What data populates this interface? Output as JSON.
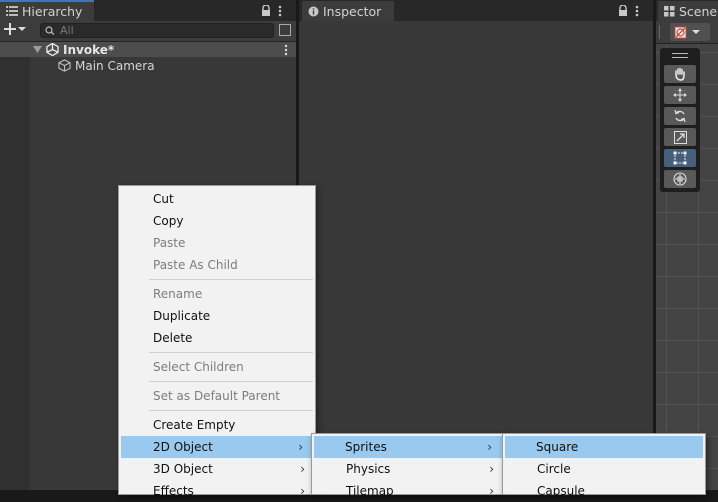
{
  "hierarchy": {
    "tab_label": "Hierarchy",
    "search_placeholder": "All",
    "scene_name": "Invoke*",
    "objects": [
      "Main Camera"
    ]
  },
  "inspector": {
    "tab_label": "Inspector"
  },
  "scene_view": {
    "tab_label": "Scene"
  },
  "context_menu": {
    "items": [
      {
        "label": "Cut",
        "enabled": true
      },
      {
        "label": "Copy",
        "enabled": true
      },
      {
        "label": "Paste",
        "enabled": false
      },
      {
        "label": "Paste As Child",
        "enabled": false
      },
      {
        "label": "Rename",
        "enabled": false
      },
      {
        "label": "Duplicate",
        "enabled": true
      },
      {
        "label": "Delete",
        "enabled": true
      },
      {
        "label": "Select Children",
        "enabled": false
      },
      {
        "label": "Set as Default Parent",
        "enabled": false
      },
      {
        "label": "Create Empty",
        "enabled": true
      },
      {
        "label": "2D Object",
        "enabled": true
      },
      {
        "label": "3D Object",
        "enabled": true
      },
      {
        "label": "Effects",
        "enabled": true
      }
    ]
  },
  "submenu_2d": {
    "items": [
      "Sprites",
      "Physics",
      "Tilemap"
    ]
  },
  "submenu_sprites": {
    "items": [
      "Square",
      "Circle",
      "Capsule"
    ]
  },
  "colors": {
    "accent": "#3a79bb",
    "menu_highlight": "#99c9ef",
    "menu_bg": "#f2f2f2"
  }
}
